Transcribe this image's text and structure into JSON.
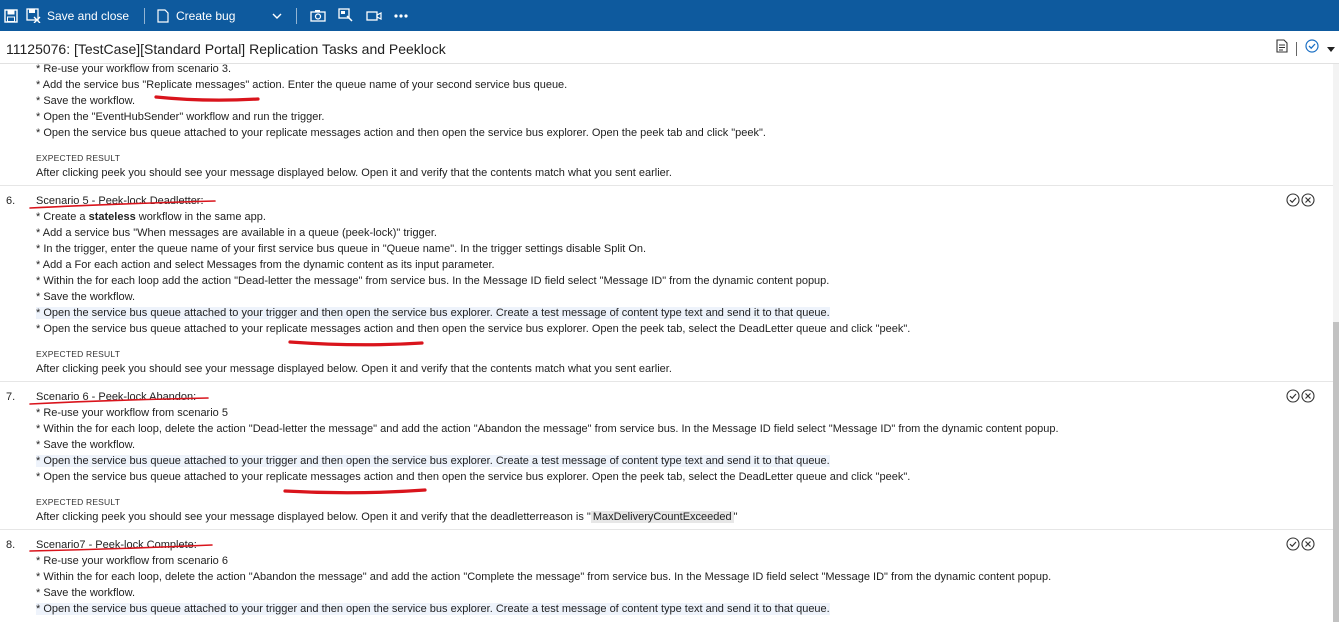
{
  "toolbar": {
    "save_close_label": "Save and close",
    "create_bug_label": "Create bug",
    "colors": {
      "bar": "#0e5a9e",
      "text": "#ffffff"
    }
  },
  "header": {
    "title": "11125076: [TestCase][Standard Portal] Replication Tasks and Peeklock"
  },
  "prev_step": {
    "lines": [
      "* Re-use your workflow from scenario 3.",
      "* Add the service bus \"Replicate messages\" action. Enter the queue name of your second service bus queue.",
      "* Save the workflow.",
      "* Open the \"EventHubSender\" workflow and run the trigger.",
      "* Open the service bus queue attached to your replicate messages action and then open the service bus explorer. Open the peek tab and click \"peek\"."
    ],
    "expected_label": "EXPECTED RESULT",
    "expected": "After clicking peek you should see your message displayed below. Open it and verify that the contents match what you sent earlier."
  },
  "steps": [
    {
      "number": "6.",
      "title": "Scenario 5 - Peek-lock Deadletter:",
      "lines": [
        "* Create a ",
        "* Add a service bus \"When messages are available in a queue (peek-lock)\" trigger.",
        "* In the trigger, enter the queue name of your first service bus queue in \"Queue name\". In the trigger settings disable Split On.",
        "* Add a For each action and select Messages from the dynamic content as its input parameter.",
        "* Within the for each loop add the action \"Dead-letter the message\" from service bus. In the Message ID field select \"Message ID\" from the dynamic content popup.",
        "* Save the workflow.",
        "* Open the service bus queue attached to your trigger and then open the service bus explorer. Create a test message of content type text and send it to that queue.",
        "* Open the service bus queue attached to your replicate messages action and then open the service bus explorer. Open the peek tab, select the DeadLetter queue and click \"peek\"."
      ],
      "bold_word": "stateless",
      "after_bold": " workflow in the same app.",
      "expected_label": "EXPECTED RESULT",
      "expected": "After clicking peek you should see your message displayed below. Open it and verify that the contents match what you sent earlier."
    },
    {
      "number": "7.",
      "title": "Scenario 6 - Peek-lock Abandon:",
      "lines": [
        "* Re-use your workflow from scenario 5",
        "* Within the for each loop, delete the action \"Dead-letter the message\" and add the action \"Abandon the message\" from service bus. In the Message ID field select \"Message ID\" from the dynamic content popup.",
        "* Save the workflow.",
        "* Open the service bus queue attached to your trigger and then open the service bus explorer. Create a test message of content type text and send it to that queue.",
        "* Open the service bus queue attached to your replicate messages action and then open the service bus explorer. Open the peek tab, select the DeadLetter queue and click \"peek\"."
      ],
      "expected_label": "EXPECTED RESULT",
      "expected_prefix": "After clicking peek you should see your message displayed below. Open it and verify that the deadletterreason is \"",
      "expected_code": "MaxDeliveryCountExceeded",
      "expected_suffix": "\""
    },
    {
      "number": "8.",
      "title": "Scenario7 - Peek-lock Complete:",
      "lines": [
        "* Re-use your workflow from scenario 6",
        "* Within the for each loop, delete the action \"Abandon the message\" and add the action \"Complete the message\" from service bus. In the Message ID field select \"Message ID\" from the dynamic content popup.",
        "* Save the workflow.",
        "* Open the service bus queue attached to your trigger and then open the service bus explorer. Create a test message of content type text and send it to that queue."
      ]
    }
  ],
  "annotation_color": "#d9141c"
}
